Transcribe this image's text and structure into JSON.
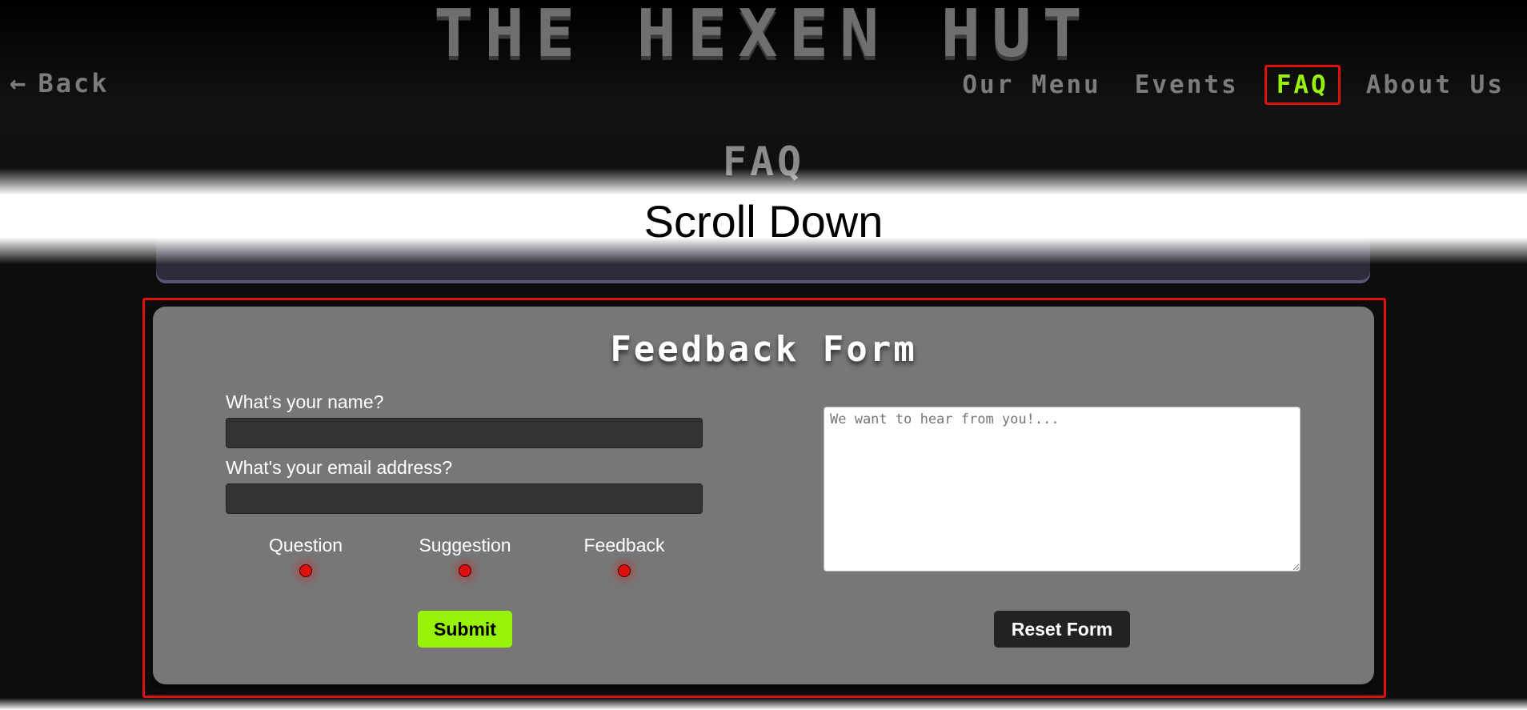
{
  "header": {
    "site_title": "THE HEXEN HUT",
    "back_label": "Back",
    "back_icon": "arrow-left-icon"
  },
  "nav": {
    "items": [
      {
        "label": "Our Menu",
        "active": false
      },
      {
        "label": "Events",
        "active": false
      },
      {
        "label": "FAQ",
        "active": true
      },
      {
        "label": "About Us",
        "active": false
      }
    ]
  },
  "page": {
    "heading": "FAQ",
    "overlay_text": "Scroll Down"
  },
  "form": {
    "title": "Feedback Form",
    "name_label": "What's your name?",
    "name_value": "",
    "email_label": "What's your email address?",
    "email_value": "",
    "radio_options": [
      "Question",
      "Suggestion",
      "Feedback"
    ],
    "message_placeholder": "We want to hear from you!...",
    "message_value": "",
    "submit_label": "Submit",
    "reset_label": "Reset Form"
  },
  "colors": {
    "accent_green": "#98f20a",
    "highlight_red": "#e01010",
    "card_gray": "#777777",
    "nav_gray": "#7c7c7c"
  }
}
